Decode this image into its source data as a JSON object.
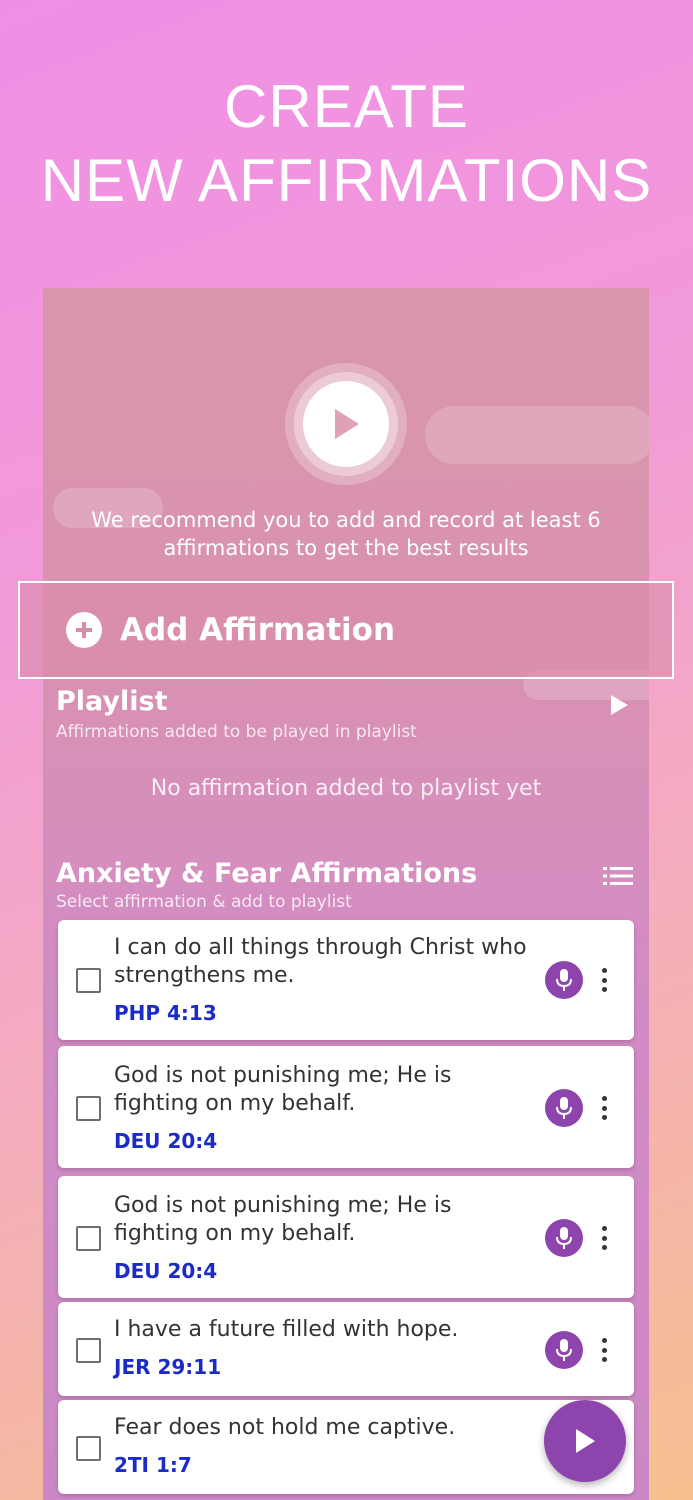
{
  "headline": {
    "line1": "CREATE",
    "line2": "NEW AFFIRMATIONS"
  },
  "player": {
    "icon": "play-icon",
    "recommendation": "We recommend you to add and record at least 6 affirmations to get the best results"
  },
  "add_affirmation": {
    "icon": "plus-circle-icon",
    "label": "Add Affirmation"
  },
  "playlist": {
    "title": "Playlist",
    "subtitle": "Affirmations added to be played in playlist",
    "empty_text": "No affirmation added to playlist yet",
    "icon": "play-icon"
  },
  "category": {
    "title": "Anxiety & Fear Affirmations",
    "subtitle": "Select affirmation & add to playlist",
    "icon": "list-icon"
  },
  "affirmations": [
    {
      "text": "I can do all things through Christ who strengthens me.",
      "ref": "PHP 4:13",
      "checked": false
    },
    {
      "text": "God is not punishing me; He is fighting on my behalf.",
      "ref": "DEU 20:4",
      "checked": false
    },
    {
      "text": "God is not punishing me; He is fighting on my behalf.",
      "ref": "DEU 20:4",
      "checked": false
    },
    {
      "text": "I have a future filled with hope.",
      "ref": "JER 29:11",
      "checked": false
    },
    {
      "text": "Fear does not hold me captive.",
      "ref": "2TI 1:7",
      "checked": false
    }
  ],
  "colors": {
    "accent": "#8e44ad",
    "reference": "#1a2bc9"
  },
  "fab": {
    "icon": "play-icon"
  }
}
